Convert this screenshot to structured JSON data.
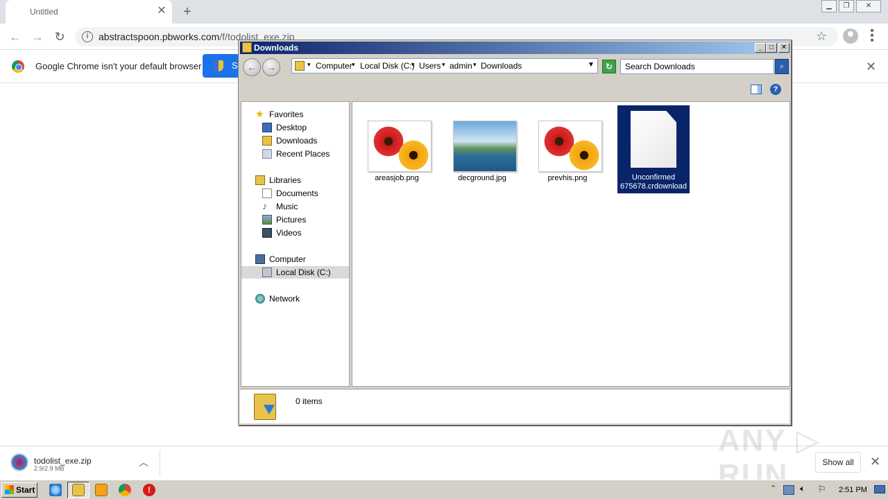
{
  "browser": {
    "tab_title": "Untitled",
    "tab_close": "✕",
    "new_tab": "+",
    "url_host": "abstractspoon.pbworks.com",
    "url_path": "/f/todolist_exe.zip",
    "infobar_text": "Google Chrome isn't your default browser",
    "set_default_label": "S"
  },
  "explorer": {
    "title": "Downloads",
    "breadcrumbs": [
      "Computer",
      "Local Disk (C:)",
      "Users",
      "admin",
      "Downloads"
    ],
    "search_placeholder": "Search Downloads",
    "nav": {
      "favorites": "Favorites",
      "desktop": "Desktop",
      "downloads": "Downloads",
      "recent": "Recent Places",
      "libraries": "Libraries",
      "documents": "Documents",
      "music": "Music",
      "pictures": "Pictures",
      "videos": "Videos",
      "computer": "Computer",
      "local_disk": "Local Disk (C:)",
      "network": "Network"
    },
    "files": [
      {
        "name": "areasjob.png"
      },
      {
        "name": "decground.jpg"
      },
      {
        "name": "prevhis.png"
      },
      {
        "name": "Unconfirmed 675678.crdownload"
      }
    ],
    "item_count": "0 items"
  },
  "shelf": {
    "filename": "todolist_exe.zip",
    "size": "2.9/2.9 MB",
    "show_all": "Show all"
  },
  "taskbar": {
    "start": "Start",
    "clock": "2:51 PM"
  }
}
